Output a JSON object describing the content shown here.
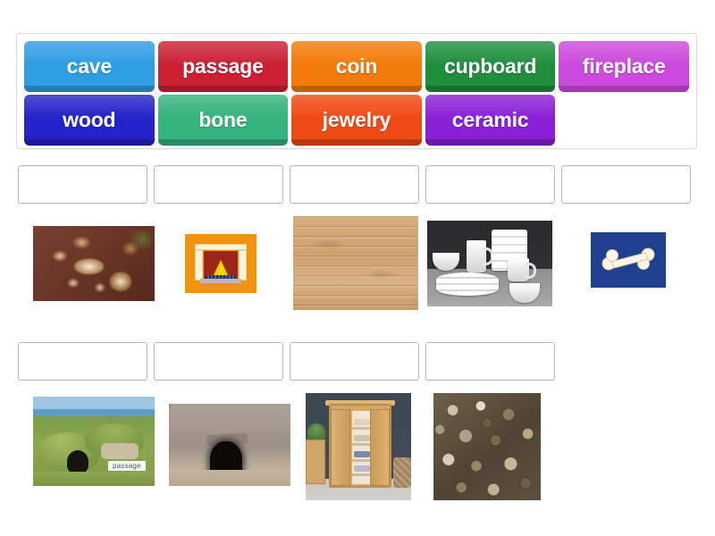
{
  "activity": {
    "type": "match-up-drag-and-drop",
    "tiles": [
      {
        "label": "cave",
        "color": "#2f9de3"
      },
      {
        "label": "passage",
        "color": "#cc2135"
      },
      {
        "label": "coin",
        "color": "#f47b0a"
      },
      {
        "label": "cupboard",
        "color": "#1f8f3d"
      },
      {
        "label": "fireplace",
        "color": "#cc4ade"
      },
      {
        "label": "wood",
        "color": "#2323c9"
      },
      {
        "label": "bone",
        "color": "#35b37e"
      },
      {
        "label": "jewelry",
        "color": "#ef4a14"
      },
      {
        "label": "ceramic",
        "color": "#8b1fd6"
      }
    ],
    "rows": [
      {
        "dropzones": [
          {
            "value": "",
            "filled": false
          },
          {
            "value": "",
            "filled": false
          },
          {
            "value": "",
            "filled": false
          },
          {
            "value": "",
            "filled": false
          },
          {
            "value": "",
            "filled": false
          }
        ],
        "images": [
          {
            "name": "jewelry-photo",
            "alt": "gold and pearl necklace with earrings on red cloth"
          },
          {
            "name": "fireplace-clipart",
            "alt": "cartoon fireplace with yellow flame on orange background"
          },
          {
            "name": "wood-planks-photo",
            "alt": "horizontal light wooden planks texture"
          },
          {
            "name": "ceramic-dishes-photo",
            "alt": "white ceramic plates, bowls and mugs"
          },
          {
            "name": "bone-clipart",
            "alt": "white bone on blue square background"
          }
        ]
      },
      {
        "dropzones": [
          {
            "value": "",
            "filled": false
          },
          {
            "value": "",
            "filled": false
          },
          {
            "value": "",
            "filled": false
          },
          {
            "value": "",
            "filled": false
          }
        ],
        "images": [
          {
            "name": "passage-village-photo",
            "alt": "grassy mounds with dark entrance by the sea",
            "caption": "passage"
          },
          {
            "name": "cave-entrance-photo",
            "alt": "rocky cliff with dark cave opening"
          },
          {
            "name": "cupboard-photo",
            "alt": "wooden cupboard with open doors and shelves"
          },
          {
            "name": "coins-photo",
            "alt": "pile of assorted metal coins"
          }
        ]
      }
    ]
  },
  "colors": {
    "page_background": "#ffffff",
    "bank_border": "#d8d8d8",
    "dropzone_border": "#b6b6b6"
  }
}
